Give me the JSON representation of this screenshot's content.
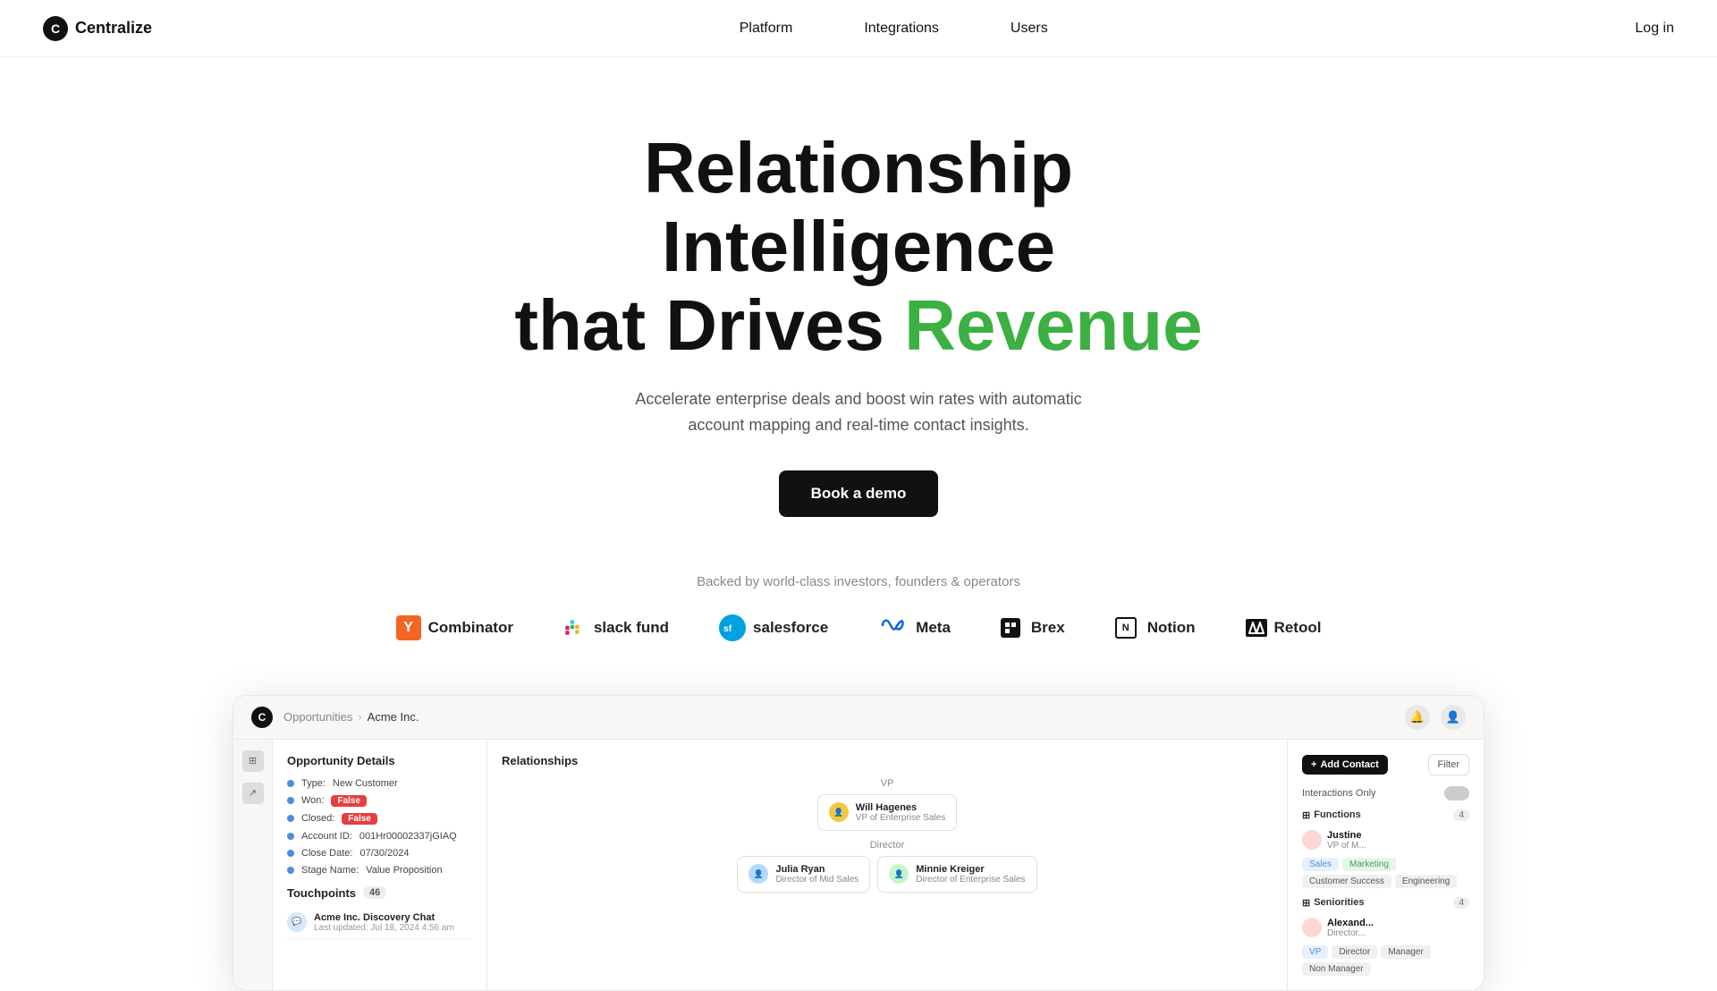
{
  "nav": {
    "logo_text": "Centralize",
    "logo_icon": "C",
    "links": [
      "Platform",
      "Integrations",
      "Users"
    ],
    "login_label": "Log in"
  },
  "hero": {
    "headline_line1": "Relationship Intelligence",
    "headline_line2_black": "that Drives",
    "headline_line2_green": "Revenue",
    "subtext": "Accelerate enterprise deals and boost win rates with automatic account mapping and real-time contact insights.",
    "cta_label": "Book a demo"
  },
  "investors": {
    "tagline": "Backed by world-class investors, founders & operators",
    "logos": [
      {
        "name": "Y Combinator",
        "display": "Combinator"
      },
      {
        "name": "Slack Fund",
        "display": "slack fund"
      },
      {
        "name": "Salesforce",
        "display": "salesforce"
      },
      {
        "name": "Meta",
        "display": "Meta"
      },
      {
        "name": "Brex",
        "display": "Brex"
      },
      {
        "name": "Notion",
        "display": "Notion"
      },
      {
        "name": "Retool",
        "display": "Retool"
      }
    ]
  },
  "screenshot": {
    "breadcrumb": {
      "parent": "Opportunities",
      "current": "Acme Inc."
    },
    "opportunity_details": {
      "title": "Opportunity Details",
      "type": "New Customer",
      "won": "False",
      "closed": "False",
      "account_id": "001Hr00002337jGIAQ",
      "close_date": "07/30/2024",
      "stage_name": "Value Proposition"
    },
    "touchpoints": {
      "title": "Touchpoints",
      "count": "46",
      "item_name": "Acme Inc. Discovery Chat",
      "item_date": "Last updated: Jul 18, 2024 4:56 am"
    },
    "relationships": {
      "title": "Relationships",
      "levels": [
        {
          "label": "VP",
          "cards": [
            {
              "name": "Will Hagenes",
              "title": "VP of Enterprise Sales"
            }
          ]
        },
        {
          "label": "Director",
          "cards": [
            {
              "name": "Julia Ryan",
              "title": "Director of Mid Sales"
            },
            {
              "name": "Minnie Kreiger",
              "title": "Director of Enterprise Sales"
            }
          ]
        }
      ]
    },
    "right_panel": {
      "add_contact_label": "Add Contact",
      "filter_label": "Filter",
      "interactions_label": "Interactions Only",
      "functions_label": "Functions",
      "functions_count": "4",
      "functions_tags": [
        "Sales",
        "Marketing",
        "Customer Success",
        "Engineering"
      ],
      "person_name": "Justine",
      "person_title": "VP of M...",
      "seniorities_label": "Seniorities",
      "seniorities_count": "4",
      "seniorities_tags": [
        "VP",
        "Director",
        "Manager",
        "Non Manager"
      ],
      "seniority_person_name": "Alexand...",
      "seniority_person_title": "Director..."
    }
  }
}
